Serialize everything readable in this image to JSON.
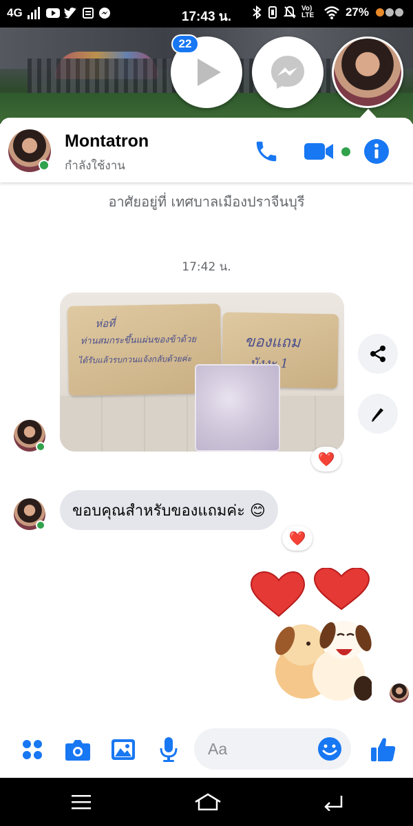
{
  "status_bar": {
    "network": "4G",
    "time": "17:43 น.",
    "battery": "27%",
    "volte": "Vo) LTE"
  },
  "chat_heads": {
    "unread_count": "22"
  },
  "header": {
    "name": "Montatron",
    "status": "กำลังใช้งาน"
  },
  "conversation": {
    "info_text": "อาศัยอยู่ที่ เทศบาลเมืองปราจีนบุรี",
    "timestamp": "17:42 น.",
    "photo_writing": {
      "left_line1": "ห่อที่",
      "left_line2": "ท่านสมกระขึ้นแผ่นของข้าด้วย",
      "left_line3": "ได้รับแล้วรบกวนแจ้งกลับด้วยค่ะ",
      "right_line1": "ของแถม",
      "right_line2": "มังงะ 1"
    },
    "text_message": "ขอบคุณสำหรับของแถมค่ะ 😊",
    "reaction_emoji": "❤️"
  },
  "composer": {
    "placeholder": "Aa"
  },
  "colors": {
    "accent": "#1877f2",
    "online": "#31a24c",
    "bubble": "#e4e6eb",
    "reaction_heart": "#f33e58"
  }
}
